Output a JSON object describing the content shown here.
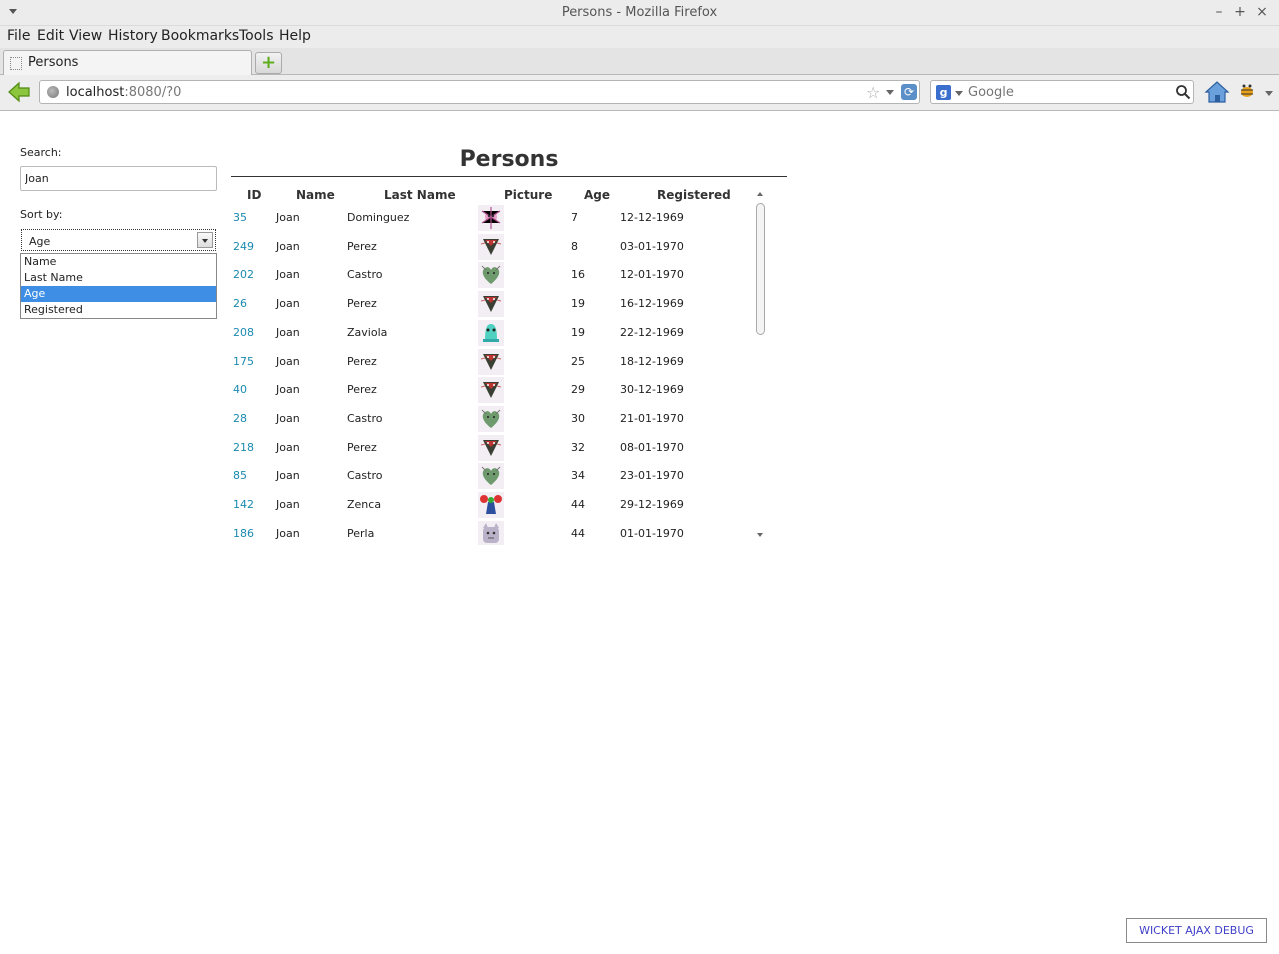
{
  "window": {
    "title": "Persons - Mozilla Firefox"
  },
  "menu": [
    "File",
    "Edit",
    "View",
    "History",
    "Bookmarks",
    "Tools",
    "Help"
  ],
  "tab": {
    "label": "Persons"
  },
  "address": {
    "host": "localhost",
    "rest": ":8080/?0"
  },
  "searchbar": {
    "placeholder": "Google",
    "engine_icon": "google-g-icon"
  },
  "page": {
    "search_label": "Search:",
    "search_value": "Joan",
    "sort_label": "Sort by:",
    "sort_selected": "Age",
    "sort_options": [
      "Name",
      "Last Name",
      "Age",
      "Registered"
    ],
    "title": "Persons",
    "columns": [
      "ID",
      "Name",
      "Last Name",
      "Picture",
      "Age",
      "Registered"
    ],
    "rows": [
      {
        "id": "35",
        "name": "Joan",
        "last": "Dominguez",
        "pic": "pink-spiky-monster",
        "age": "7",
        "registered": "12-12-1969"
      },
      {
        "id": "249",
        "name": "Joan",
        "last": "Perez",
        "pic": "dark-triangle-monster",
        "age": "8",
        "registered": "03-01-1970"
      },
      {
        "id": "202",
        "name": "Joan",
        "last": "Castro",
        "pic": "green-heart-monster",
        "age": "16",
        "registered": "12-01-1970"
      },
      {
        "id": "26",
        "name": "Joan",
        "last": "Perez",
        "pic": "dark-triangle-monster",
        "age": "19",
        "registered": "16-12-1969"
      },
      {
        "id": "208",
        "name": "Joan",
        "last": "Zaviola",
        "pic": "teal-bell-monster",
        "age": "19",
        "registered": "22-12-1969"
      },
      {
        "id": "175",
        "name": "Joan",
        "last": "Perez",
        "pic": "dark-triangle-monster",
        "age": "25",
        "registered": "18-12-1969"
      },
      {
        "id": "40",
        "name": "Joan",
        "last": "Perez",
        "pic": "dark-triangle-monster",
        "age": "29",
        "registered": "30-12-1969"
      },
      {
        "id": "28",
        "name": "Joan",
        "last": "Castro",
        "pic": "green-heart-monster",
        "age": "30",
        "registered": "21-01-1970"
      },
      {
        "id": "218",
        "name": "Joan",
        "last": "Perez",
        "pic": "dark-triangle-monster",
        "age": "32",
        "registered": "08-01-1970"
      },
      {
        "id": "85",
        "name": "Joan",
        "last": "Castro",
        "pic": "green-heart-monster",
        "age": "34",
        "registered": "23-01-1970"
      },
      {
        "id": "142",
        "name": "Joan",
        "last": "Zenca",
        "pic": "blue-red-monster",
        "age": "44",
        "registered": "29-12-1969"
      },
      {
        "id": "186",
        "name": "Joan",
        "last": "Perla",
        "pic": "gray-cat-monster",
        "age": "44",
        "registered": "01-01-1970"
      }
    ],
    "debug_button": "WICKET AJAX DEBUG"
  },
  "colors": {
    "link": "#1b8ab0",
    "selection": "#3d8ee4",
    "debug_text": "#4040c8"
  }
}
